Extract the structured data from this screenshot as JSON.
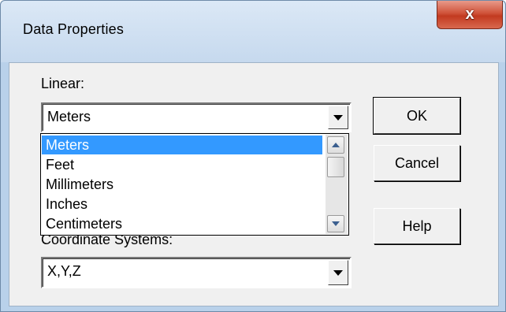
{
  "dialog": {
    "title": "Data Properties",
    "close_glyph": "x"
  },
  "linear": {
    "label": "Linear:",
    "value": "Meters",
    "options": [
      "Meters",
      "Feet",
      "Millimeters",
      "Inches",
      "Centimeters"
    ],
    "selected": "Meters"
  },
  "coordinate": {
    "label": "Coordinate Systems:",
    "value": "X,Y,Z"
  },
  "buttons": {
    "ok": "OK",
    "cancel": "Cancel",
    "help": "Help"
  },
  "colors": {
    "selection": "#3399ff",
    "close_button": "#c23a20",
    "titlebar": "#c6d9ee"
  },
  "icons": [
    "close-icon",
    "chevron-down-icon",
    "scroll-up-icon",
    "scroll-down-icon"
  ]
}
